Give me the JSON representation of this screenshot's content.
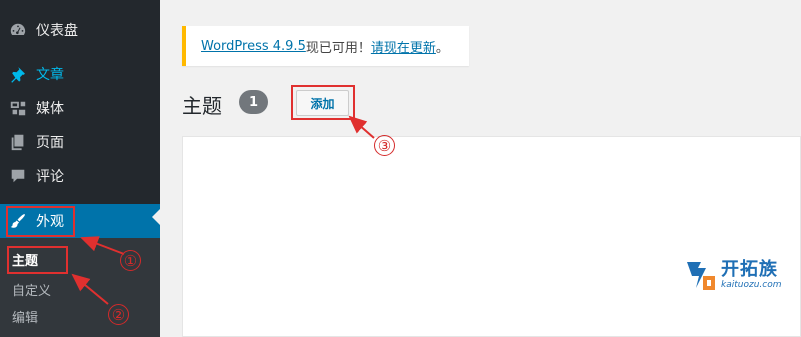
{
  "sidebar": {
    "items": [
      {
        "label": "仪表盘",
        "icon": "dashboard-icon"
      },
      {
        "label": "文章",
        "icon": "pushpin-icon"
      },
      {
        "label": "媒体",
        "icon": "media-icon"
      },
      {
        "label": "页面",
        "icon": "pages-icon"
      },
      {
        "label": "评论",
        "icon": "comment-icon"
      },
      {
        "label": "外观",
        "icon": "paintbrush-icon"
      }
    ],
    "submenu": [
      {
        "label": "主题"
      },
      {
        "label": "自定义"
      },
      {
        "label": "编辑"
      }
    ]
  },
  "notice": {
    "version_link": "WordPress 4.9.5",
    "available_text": "现已可用！",
    "update_link": "请现在更新",
    "end_punct": "。"
  },
  "header": {
    "title": "主题",
    "count": "1",
    "add_label": "添加"
  },
  "annotations": {
    "one": "①",
    "two": "②",
    "three": "③"
  },
  "watermark": {
    "name": "开拓族",
    "domain": "kaituozu.com"
  },
  "colors": {
    "sidebar_bg": "#23282d",
    "accent": "#0073aa",
    "notice_border": "#ffb900",
    "annotation_red": "#e0302f"
  }
}
